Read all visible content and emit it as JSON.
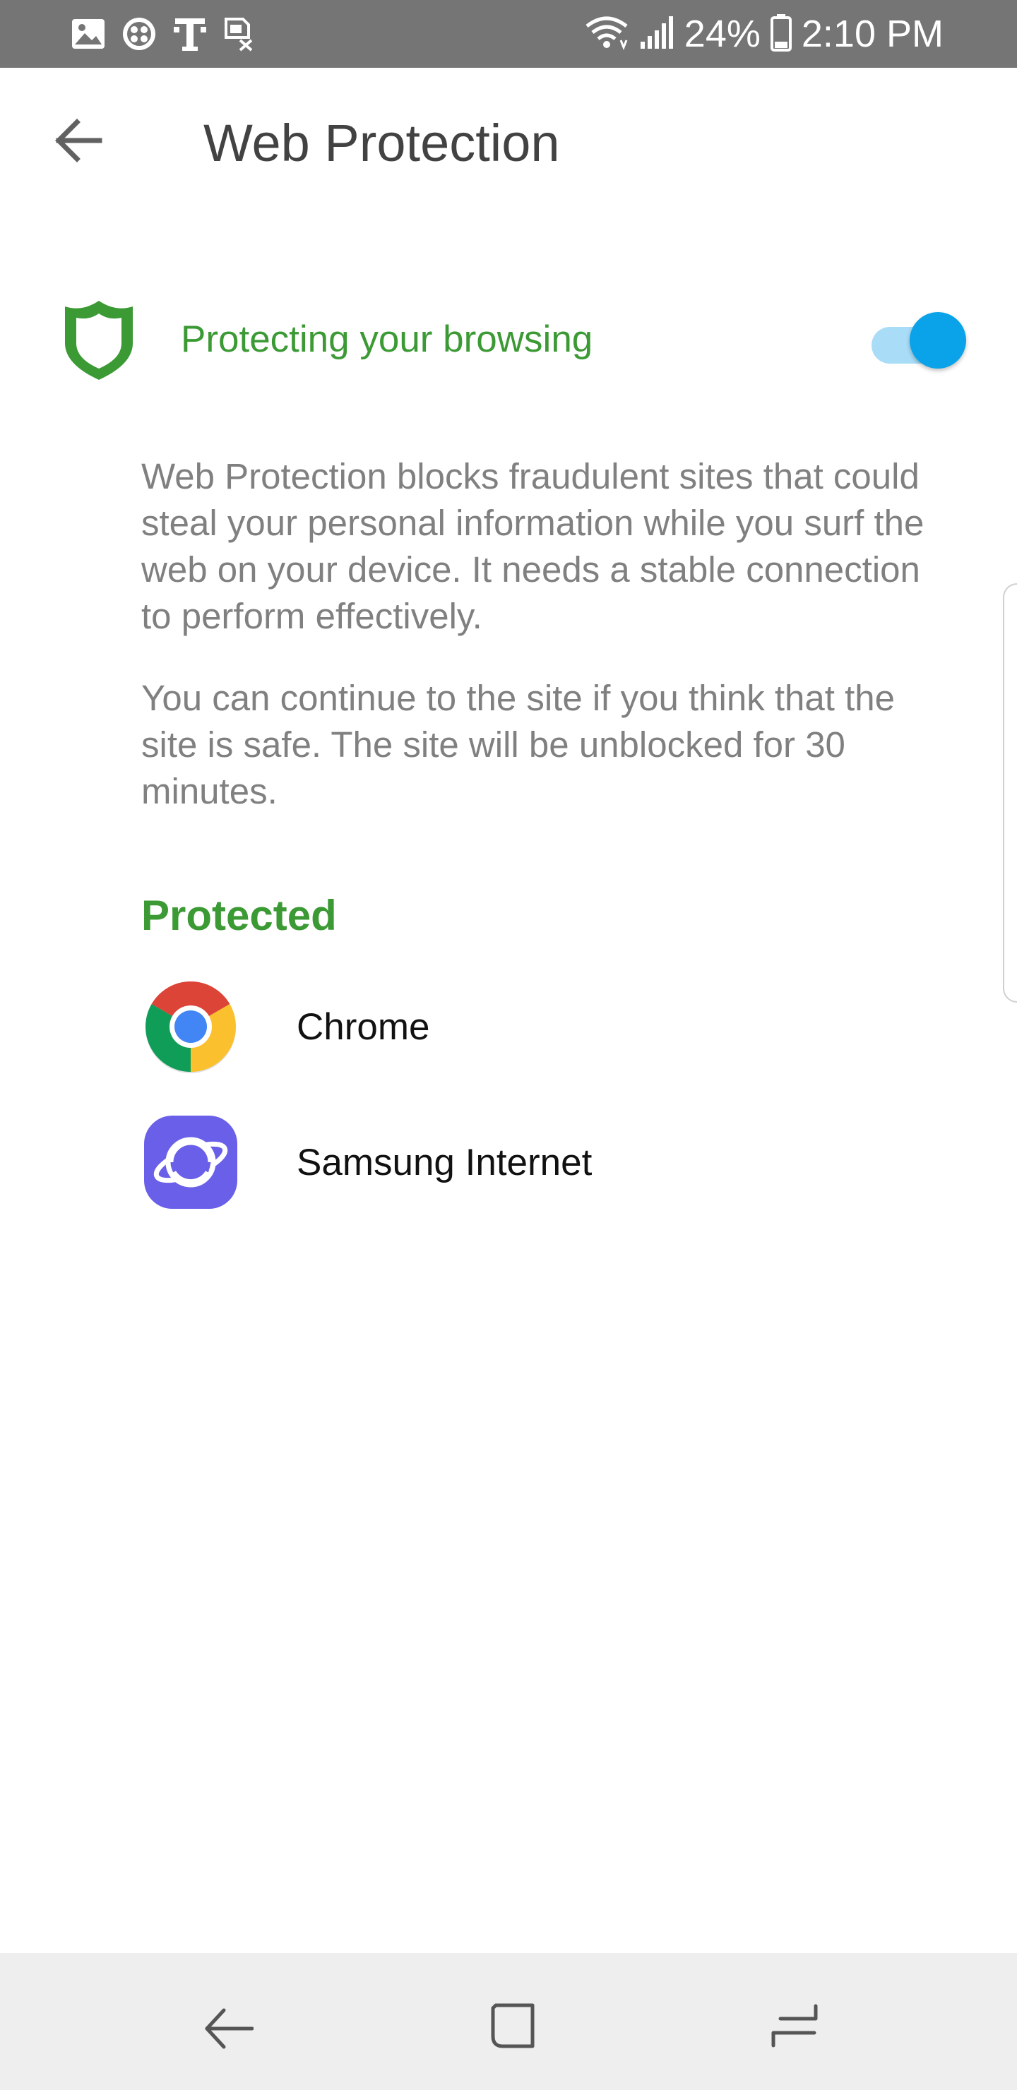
{
  "status_bar": {
    "battery": "24%",
    "time": "2:10 PM",
    "left_icons": [
      "gallery-icon",
      "app-icon",
      "t-mobile-icon",
      "sim-icon"
    ],
    "right_icons": [
      "wifi-icon",
      "signal-icon",
      "battery-icon"
    ]
  },
  "header": {
    "title": "Web Protection",
    "back_icon": "arrow-left-icon"
  },
  "protection": {
    "label": "Protecting your browsing",
    "enabled": true,
    "accent_color": "#3c9a35",
    "toggle_color": "#0aa3ea"
  },
  "description": {
    "paragraph_1": "Web Protection blocks fraudulent sites that could steal your personal information while you surf the web on your device. It needs a stable connection to perform effectively.",
    "paragraph_2": "You can continue to the site if you think that the site is safe. The site will be unblocked for 30 minutes."
  },
  "protected": {
    "heading": "Protected",
    "apps": [
      {
        "name": "Chrome",
        "icon": "chrome-icon"
      },
      {
        "name": "Samsung Internet",
        "icon": "samsung-internet-icon"
      }
    ]
  },
  "nav_bar": {
    "buttons": [
      "back-icon",
      "home-icon",
      "recents-icon"
    ]
  }
}
